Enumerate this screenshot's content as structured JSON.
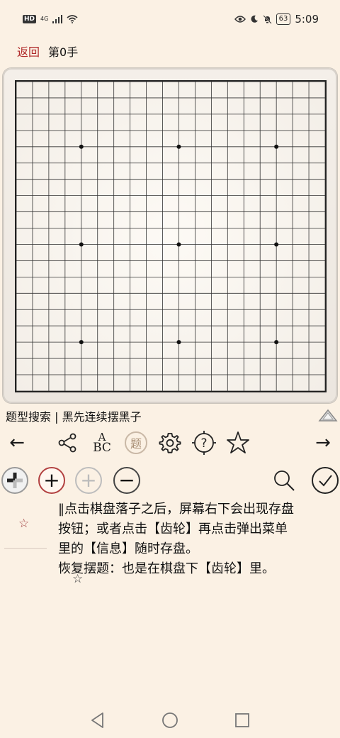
{
  "status": {
    "hd": "HD",
    "network": "4G",
    "battery": "63",
    "time": "5:09"
  },
  "header": {
    "back_label": "返回",
    "move_label": "第0手"
  },
  "board": {
    "size": 19,
    "star_points": [
      [
        3,
        3
      ],
      [
        9,
        3
      ],
      [
        15,
        3
      ],
      [
        3,
        9
      ],
      [
        9,
        9
      ],
      [
        15,
        9
      ],
      [
        3,
        15
      ],
      [
        9,
        15
      ],
      [
        15,
        15
      ]
    ]
  },
  "problem": {
    "title": "题型搜索 | 黑先连续摆黑子"
  },
  "toolbar": {
    "prev": "←",
    "next": "→",
    "icons": [
      "share-icon",
      "abc-icon",
      "problem-icon",
      "gear-icon",
      "hint-icon",
      "star-icon"
    ],
    "abc_top": "A",
    "abc_bottom": "BC",
    "problem_glyph": "题",
    "hint_glyph": "?"
  },
  "actions": {
    "plus": "+",
    "minus": "−"
  },
  "notes": {
    "star_left": "☆",
    "star_mid": "☆",
    "lines": [
      "‖点击棋盘落子之后，屏幕右下会出现存盘",
      "按钮；或者点击【齿轮】再点击弹出菜单",
      "里的【信息】随时存盘。",
      "恢复摆题：也是在棋盘下【齿轮】里。"
    ]
  }
}
